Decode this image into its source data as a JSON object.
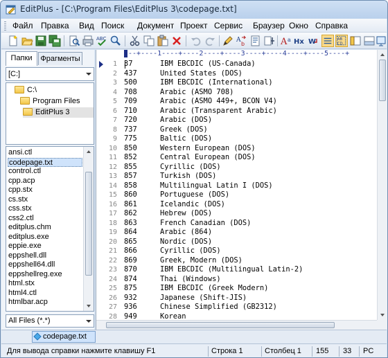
{
  "window": {
    "title": "EditPlus - [C:\\Program Files\\EditPlus 3\\codepage.txt]"
  },
  "menu": [
    "Файл",
    "Правка",
    "Вид",
    "Поиск",
    "Документ",
    "Проект",
    "Сервис",
    "Браузер",
    "Окно",
    "Справка"
  ],
  "toolbar_icons": [
    "new-icon",
    "open-icon",
    "save-icon",
    "save-all-icon",
    "print-preview-icon",
    "print-icon",
    "spell-check-icon",
    "find-icon",
    "cut-icon",
    "copy-icon",
    "paste-icon",
    "delete-icon",
    "undo-icon",
    "redo-icon",
    "highlight-icon",
    "replace-icon",
    "template-icon",
    "insert-icon",
    "font-icon",
    "hex-icon",
    "word-wrap-icon",
    "line-numbers-icon",
    "column-select-icon",
    "abcd-icon",
    "sidebar-icon",
    "output-icon",
    "screen-icon"
  ],
  "left_panel": {
    "tabs": [
      "Папки",
      "Фрагменты"
    ],
    "drive": "[C:]",
    "tree": [
      "C:\\",
      "Program Files",
      "EditPlus 3"
    ],
    "files": [
      "ansi.ctl",
      "codepage.txt",
      "control.ctl",
      "cpp.acp",
      "cpp.stx",
      "cs.stx",
      "css.stx",
      "css2.ctl",
      "editplus.chm",
      "editplus.exe",
      "eppie.exe",
      "eppshell.dll",
      "eppshell64.dll",
      "eppshellreg.exe",
      "html.stx",
      "html4.ctl",
      "htmlbar.acp"
    ],
    "filter": "All Files (*.*)"
  },
  "editor": {
    "ruler": "---+----1----+----2----+----3----+----4----+----5----+",
    "lines": [
      {
        "n": "1",
        "code": "37",
        "name": "IBM EBCDIC (US-Canada)"
      },
      {
        "n": "2",
        "code": "437",
        "name": "United States (DOS)"
      },
      {
        "n": "3",
        "code": "500",
        "name": "IBM EBCDIC (International)"
      },
      {
        "n": "4",
        "code": "708",
        "name": "Arabic (ASMO 708)"
      },
      {
        "n": "5",
        "code": "709",
        "name": "Arabic (ASMO 449+, BCON V4)"
      },
      {
        "n": "6",
        "code": "710",
        "name": "Arabic (Transparent Arabic)"
      },
      {
        "n": "7",
        "code": "720",
        "name": "Arabic (DOS)"
      },
      {
        "n": "8",
        "code": "737",
        "name": "Greek (DOS)"
      },
      {
        "n": "9",
        "code": "775",
        "name": "Baltic (DOS)"
      },
      {
        "n": "10",
        "code": "850",
        "name": "Western European (DOS)"
      },
      {
        "n": "11",
        "code": "852",
        "name": "Central European (DOS)"
      },
      {
        "n": "12",
        "code": "855",
        "name": "Cyrillic (DOS)"
      },
      {
        "n": "13",
        "code": "857",
        "name": "Turkish (DOS)"
      },
      {
        "n": "14",
        "code": "858",
        "name": "Multilingual Latin I (DOS)"
      },
      {
        "n": "15",
        "code": "860",
        "name": "Portuguese (DOS)"
      },
      {
        "n": "16",
        "code": "861",
        "name": "Icelandic (DOS)"
      },
      {
        "n": "17",
        "code": "862",
        "name": "Hebrew (DOS)"
      },
      {
        "n": "18",
        "code": "863",
        "name": "French Canadian (DOS)"
      },
      {
        "n": "19",
        "code": "864",
        "name": "Arabic (864)"
      },
      {
        "n": "20",
        "code": "865",
        "name": "Nordic (DOS)"
      },
      {
        "n": "21",
        "code": "866",
        "name": "Cyrillic (DOS)"
      },
      {
        "n": "22",
        "code": "869",
        "name": "Greek, Modern (DOS)"
      },
      {
        "n": "23",
        "code": "870",
        "name": "IBM EBCDIC (Multilingual Latin-2)"
      },
      {
        "n": "24",
        "code": "874",
        "name": "Thai (Windows)"
      },
      {
        "n": "25",
        "code": "875",
        "name": "IBM EBCDIC (Greek Modern)"
      },
      {
        "n": "26",
        "code": "932",
        "name": "Japanese (Shift-JIS)"
      },
      {
        "n": "27",
        "code": "936",
        "name": "Chinese Simplified (GB2312)"
      },
      {
        "n": "28",
        "code": "949",
        "name": "Korean"
      }
    ]
  },
  "doc_tab": "codepage.txt",
  "status": {
    "help": "Для вывода справки нажмите клавишу F1",
    "line": "Строка 1",
    "col": "Столбец 1",
    "lines_total": "155",
    "size": "33",
    "enc": "PC"
  }
}
